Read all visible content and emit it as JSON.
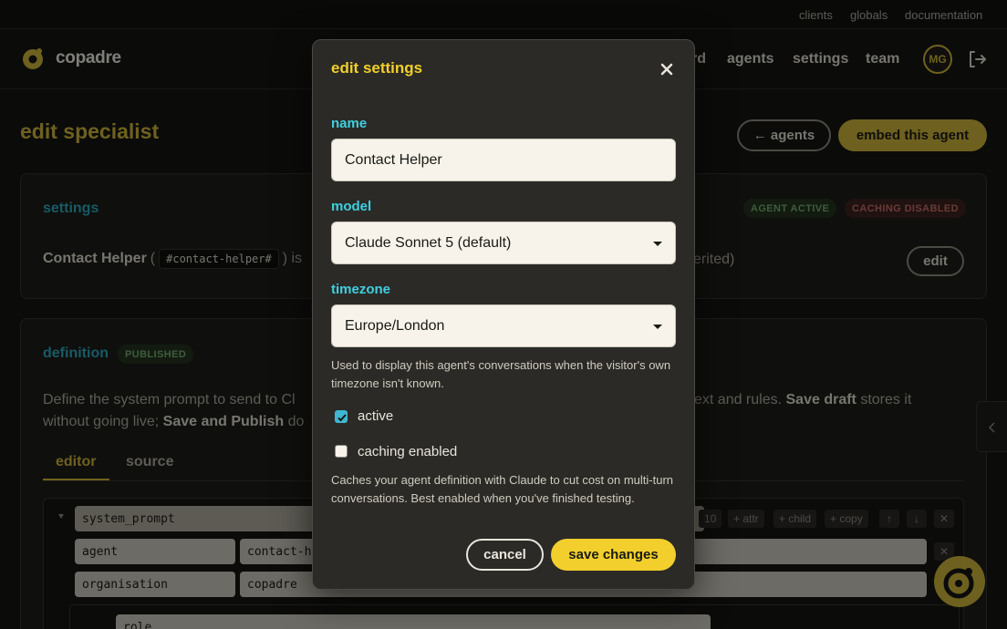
{
  "utilbar": {
    "links": [
      "clients",
      "globals",
      "documentation"
    ]
  },
  "header": {
    "brand": "copadre",
    "nav": [
      "dashboard",
      "agents",
      "settings",
      "team"
    ],
    "nav_visible_fragment": "rd",
    "avatar_initials": "MG"
  },
  "page": {
    "title": "edit specialist",
    "back_button": "← agents",
    "embed_button": "embed this agent"
  },
  "settings_card": {
    "title": "settings",
    "badge_active": "AGENT ACTIVE",
    "badge_caching": "CACHING DISABLED",
    "agent_name": "Contact Helper",
    "paren_open": "(",
    "slug": "#contact-helper#",
    "text_after_slug": ") is",
    "text_right_fragment": "erited)",
    "edit_button": "edit"
  },
  "definition_card": {
    "title": "definition",
    "badge": "PUBLISHED",
    "line1_left": "Define the system prompt to send to Cl",
    "line1_right_plain": "ext and rules. ",
    "line1_right_bold": "Save draft",
    "line1_right_tail": " stores it",
    "line2_plain": "without going live; ",
    "line2_bold": "Save and Publish",
    "line2_tail": " do",
    "tabs": [
      "editor",
      "source"
    ],
    "rows": {
      "root_key": "system_prompt",
      "count": "10",
      "attr_btn": "+ attr",
      "child_btn": "+ child",
      "copy_btn": "+ copy",
      "agent_key": "agent",
      "agent_val": "contact-he",
      "org_key": "organisation",
      "org_val": "copadre",
      "role_key": "role"
    }
  },
  "modal": {
    "title": "edit settings",
    "name_label": "name",
    "name_value": "Contact Helper",
    "model_label": "model",
    "model_value": "Claude Sonnet 5 (default)",
    "timezone_label": "timezone",
    "timezone_value": "Europe/London",
    "timezone_help": "Used to display this agent's conversations when the visitor's own timezone isn't known.",
    "active_label": "active",
    "active_checked": true,
    "caching_label": "caching enabled",
    "caching_checked": false,
    "caching_help": "Caches your agent definition with Claude to cut cost on multi-turn conversations. Best enabled when you've finished testing.",
    "cancel_label": "cancel",
    "save_label": "save changes"
  },
  "colors": {
    "accent_yellow": "#f2cf2c",
    "brand_gold": "#c9b13a",
    "label_cyan": "#3fd0e0",
    "section_teal": "#2aa7b8"
  },
  "icons": [
    "logo-icon",
    "logout-icon",
    "close-icon",
    "chevron-down-icon",
    "chevron-left-icon",
    "collapse-triangle-icon",
    "arrow-up-icon",
    "arrow-down-icon",
    "close-small-icon",
    "chat-widget-icon"
  ]
}
